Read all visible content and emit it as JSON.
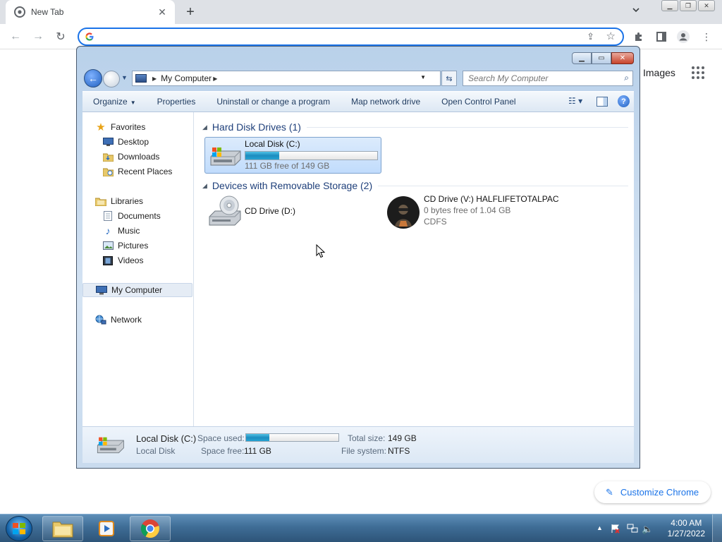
{
  "chrome": {
    "tab_title": "New Tab",
    "images_link": "Images",
    "customize_label": "Customize Chrome",
    "omnibox_value": ""
  },
  "explorer": {
    "breadcrumb": "My Computer",
    "search_placeholder": "Search My Computer",
    "commands": {
      "organize": "Organize",
      "properties": "Properties",
      "uninstall": "Uninstall or change a program",
      "map_drive": "Map network drive",
      "control_panel": "Open Control Panel"
    },
    "nav": {
      "favorites": "Favorites",
      "desktop": "Desktop",
      "downloads": "Downloads",
      "recent_places": "Recent Places",
      "libraries": "Libraries",
      "documents": "Documents",
      "music": "Music",
      "pictures": "Pictures",
      "videos": "Videos",
      "my_computer": "My Computer",
      "network": "Network"
    },
    "groups": {
      "hard_disks": "Hard Disk Drives (1)",
      "removable": "Devices with Removable Storage (2)"
    },
    "drives": {
      "c": {
        "name": "Local Disk (C:)",
        "free": "111 GB free of 149 GB",
        "used_fraction": 0.255
      },
      "d": {
        "name": "CD Drive (D:)"
      },
      "v": {
        "name": "CD Drive (V:) HALFLIFETOTALPAC",
        "free": "0 bytes free of 1.04 GB",
        "fs": "CDFS"
      }
    },
    "details": {
      "name": "Local Disk (C:)",
      "type": "Local Disk",
      "space_used_label": "Space used:",
      "space_free_label": "Space free:",
      "space_free_value": "111 GB",
      "total_size_label": "Total size:",
      "total_size_value": "149 GB",
      "file_system_label": "File system:",
      "file_system_value": "NTFS",
      "used_fraction": 0.255
    }
  },
  "taskbar": {
    "time": "4:00 AM",
    "date": "1/27/2022"
  },
  "colors": {
    "chrome_accent": "#1a73e8",
    "explorer_frame": "#b9d1ea",
    "usage_fill": "#26a3d2",
    "taskbar": "#3f6d96"
  }
}
